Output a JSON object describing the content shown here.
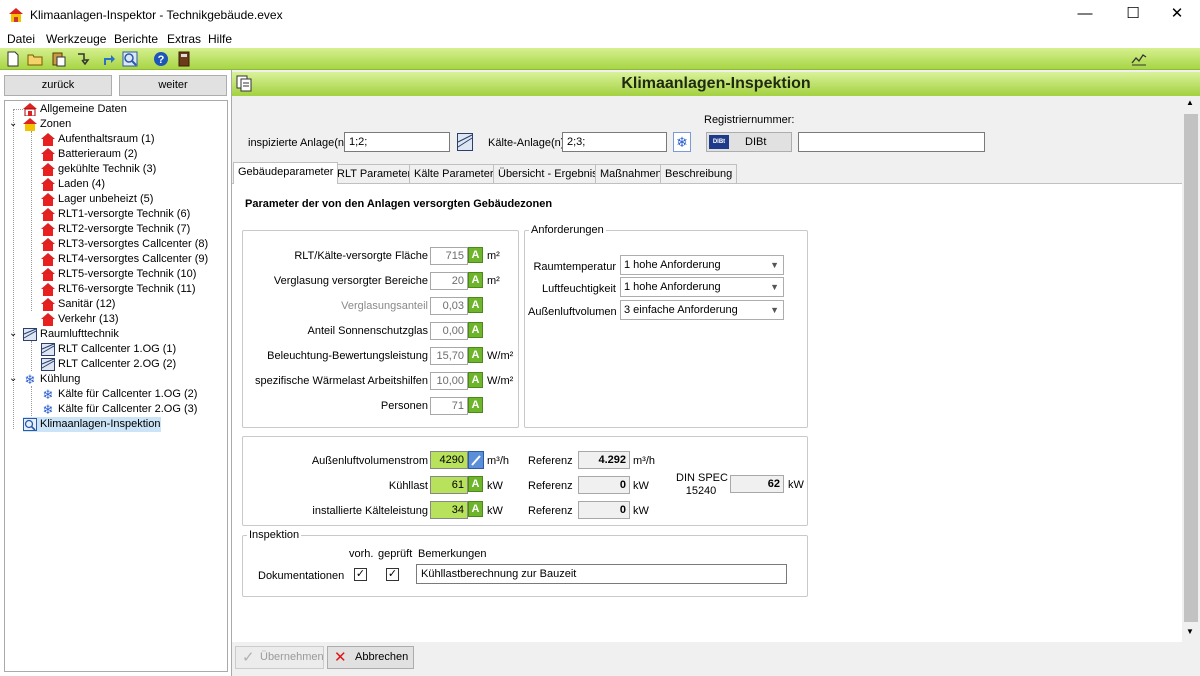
{
  "window": {
    "title": "Klimaanlagen-Inspektor - Technikgebäude.evex",
    "minimize": "—",
    "maximize": "☐",
    "close": "✕"
  },
  "menu": [
    "Datei",
    "Werkzeuge",
    "Berichte",
    "Extras",
    "Hilfe"
  ],
  "nav": {
    "back": "zurück",
    "forward": "weiter"
  },
  "tree": {
    "general": "Allgemeine Daten",
    "zones_label": "Zonen",
    "zones": [
      "Aufenthaltsraum (1)",
      "Batterieraum (2)",
      "gekühlte Technik (3)",
      "Laden (4)",
      "Lager unbeheizt (5)",
      "RLT1-versorgte Technik (6)",
      "RLT2-versorgte Technik (7)",
      "RLT3-versorgtes Callcenter (8)",
      "RLT4-versorgtes Callcenter (9)",
      "RLT5-versorgte Technik (10)",
      "RLT6-versorgte Technik (11)",
      "Sanitär (12)",
      "Verkehr (13)"
    ],
    "rlt_label": "Raumlufttechnik",
    "rlt": [
      "RLT Callcenter 1.OG (1)",
      "RLT Callcenter 2.OG (2)"
    ],
    "cool_label": "Kühlung",
    "cool": [
      "Kälte für Callcenter 1.OG (2)",
      "Kälte für Callcenter 2.OG (3)"
    ],
    "inspection": "Klimaanlagen-Inspektion"
  },
  "header": {
    "title": "Klimaanlagen-Inspektion"
  },
  "top": {
    "inspected_label": "inspizierte Anlage(n)",
    "inspected_value": "1;2;",
    "cold_label": "Kälte-Anlage(n)",
    "cold_value": "2;3;",
    "reg_label": "Registriernummer:",
    "dibt_logo": "DIBt",
    "dibt_label": "DIBt",
    "reg_value": ""
  },
  "tabs": [
    "Gebäudeparameter",
    "RLT Parameter",
    "Kälte Parameter",
    "Übersicht - Ergebnis",
    "Maßnahmen",
    "Beschreibung"
  ],
  "page": {
    "heading": "Parameter der von den Anlagen versorgten Gebäudezonen",
    "params": [
      {
        "label": "RLT/Kälte-versorgte Fläche",
        "value": "715",
        "badge": "A",
        "unit": "m²",
        "dim": false
      },
      {
        "label": "Verglasung versorgter Bereiche",
        "value": "20",
        "badge": "A",
        "unit": "m²",
        "dim": false
      },
      {
        "label": "Verglasungsanteil",
        "value": "0,03",
        "badge": "A",
        "unit": "",
        "dim": true
      },
      {
        "label": "Anteil Sonnenschutzglas",
        "value": "0,00",
        "badge": "A",
        "unit": "",
        "dim": false
      },
      {
        "label": "Beleuchtung-Bewertungsleistung",
        "value": "15,70",
        "badge": "A",
        "unit": "W/m²",
        "dim": false
      },
      {
        "label": "spezifische Wärmelast Arbeitshilfen",
        "value": "10,00",
        "badge": "A",
        "unit": "W/m²",
        "dim": false
      },
      {
        "label": "Personen",
        "value": "71",
        "badge": "A",
        "unit": "",
        "dim": false
      }
    ],
    "req_title": "Anforderungen",
    "reqs": [
      {
        "label": "Raumtemperatur",
        "value": "1 hohe Anforderung"
      },
      {
        "label": "Luftfeuchtigkeit",
        "value": "1 hohe Anforderung"
      },
      {
        "label": "Außenluftvolumen",
        "value": "3 einfache Anforderung"
      }
    ],
    "calc": [
      {
        "label": "Außenluftvolumenstrom",
        "value": "4290",
        "unit": "m³/h",
        "ref_label": "Referenz",
        "ref_value": "4.292",
        "ref_unit": "m³/h"
      },
      {
        "label": "Kühllast",
        "value": "61",
        "badge": "A",
        "unit": "kW",
        "ref_label": "Referenz",
        "ref_value": "0",
        "ref_unit": "kW"
      },
      {
        "label": "installierte Kälteleistung",
        "value": "34",
        "badge": "A",
        "unit": "kW",
        "ref_label": "Referenz",
        "ref_value": "0",
        "ref_unit": "kW"
      }
    ],
    "din_label1": "DIN SPEC",
    "din_label2": "15240",
    "din_value": "62",
    "din_unit": "kW",
    "insp_title": "Inspektion",
    "col_vorh": "vorh.",
    "col_geprueft": "geprüft",
    "col_bemerkungen": "Bemerkungen",
    "doc_label": "Dokumentationen",
    "doc_check": "✓",
    "doc_remark": "Kühllastberechnung zur Bauzeit"
  },
  "buttons": {
    "apply": "Übernehmen",
    "cancel": "Abbrechen"
  },
  "colors": {
    "accent_green": "#a3d13f",
    "value_green": "#b8e25c",
    "badge_green": "#6fb52c"
  }
}
